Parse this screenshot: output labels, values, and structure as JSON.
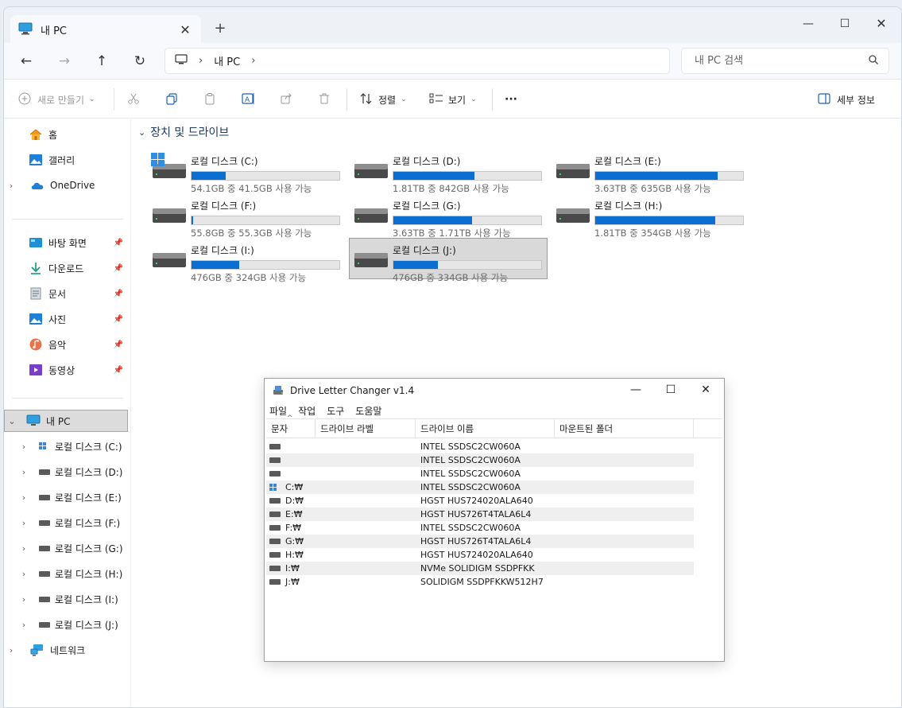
{
  "tab": {
    "title": "내 PC",
    "close": "✕",
    "new": "+"
  },
  "window_controls": {
    "minimize": "—",
    "maximize": "☐",
    "close": "✕"
  },
  "nav": {
    "back": "←",
    "forward": "→",
    "up": "↑",
    "refresh": "↻"
  },
  "address": {
    "separator": "›",
    "crumb": "내 PC"
  },
  "search": {
    "placeholder": "내 PC 검색"
  },
  "toolbar": {
    "new": "새로 만들기",
    "sort": "정렬",
    "view": "보기",
    "more": "···",
    "details": "세부 정보"
  },
  "sidebar": {
    "home": "홈",
    "gallery": "갤러리",
    "onedrive": "OneDrive",
    "quick": [
      {
        "label": "바탕 화면",
        "icon": "desktop-icon"
      },
      {
        "label": "다운로드",
        "icon": "download-icon"
      },
      {
        "label": "문서",
        "icon": "documents-icon"
      },
      {
        "label": "사진",
        "icon": "pictures-icon"
      },
      {
        "label": "음악",
        "icon": "music-icon"
      },
      {
        "label": "동영상",
        "icon": "videos-icon"
      }
    ],
    "this_pc": "내 PC",
    "drives": [
      "로컬 디스크 (C:)",
      "로컬 디스크 (D:)",
      "로컬 디스크 (E:)",
      "로컬 디스크 (F:)",
      "로컬 디스크 (G:)",
      "로컬 디스크 (H:)",
      "로컬 디스크 (I:)",
      "로컬 디스크 (J:)"
    ],
    "network": "네트워크"
  },
  "content": {
    "section_title": "장치 및 드라이브",
    "drives": [
      {
        "name": "로컬 디스크 (C:)",
        "size": "54.1GB 중 41.5GB 사용 가능",
        "used_fraction": 0.23,
        "system": true
      },
      {
        "name": "로컬 디스크 (D:)",
        "size": "1.81TB 중 842GB 사용 가능",
        "used_fraction": 0.55
      },
      {
        "name": "로컬 디스크 (E:)",
        "size": "3.63TB 중 635GB 사용 가능",
        "used_fraction": 0.83
      },
      {
        "name": "로컬 디스크 (F:)",
        "size": "55.8GB 중 55.3GB 사용 가능",
        "used_fraction": 0.01
      },
      {
        "name": "로컬 디스크 (G:)",
        "size": "3.63TB 중 1.71TB 사용 가능",
        "used_fraction": 0.53
      },
      {
        "name": "로컬 디스크 (H:)",
        "size": "1.81TB 중 354GB 사용 가능",
        "used_fraction": 0.81
      },
      {
        "name": "로컬 디스크 (I:)",
        "size": "476GB 중 324GB 사용 가능",
        "used_fraction": 0.32
      },
      {
        "name": "로컬 디스크 (J:)",
        "size": "476GB 중 334GB 사용 가능",
        "used_fraction": 0.3,
        "selected": true
      }
    ]
  },
  "dlc": {
    "title": "Drive Letter Changer v1.4",
    "menu": [
      "파일",
      "작업",
      "도구",
      "도움말"
    ],
    "columns": [
      "문자",
      "드라이브 라벨",
      "드라이브 이름",
      "마운트된 폴더"
    ],
    "rows": [
      {
        "letter": "",
        "name": "INTEL SSDSC2CW060A",
        "type": "drive"
      },
      {
        "letter": "",
        "name": "INTEL SSDSC2CW060A",
        "type": "drive"
      },
      {
        "letter": "",
        "name": "INTEL SSDSC2CW060A",
        "type": "drive"
      },
      {
        "letter": "C:₩",
        "name": "INTEL SSDSC2CW060A",
        "type": "system"
      },
      {
        "letter": "D:₩",
        "name": "HGST HUS724020ALA640",
        "type": "drive"
      },
      {
        "letter": "E:₩",
        "name": "HGST HUS726T4TALA6L4",
        "type": "drive"
      },
      {
        "letter": "F:₩",
        "name": "INTEL SSDSC2CW060A",
        "type": "drive"
      },
      {
        "letter": "G:₩",
        "name": "HGST HUS726T4TALA6L4",
        "type": "drive"
      },
      {
        "letter": "H:₩",
        "name": "HGST HUS724020ALA640",
        "type": "drive"
      },
      {
        "letter": "I:₩",
        "name": "NVMe SOLIDIGM SSDPFKK",
        "type": "drive"
      },
      {
        "letter": "J:₩",
        "name": "SOLIDIGM SSDPFKKW512H7",
        "type": "drive"
      }
    ]
  },
  "colors": {
    "accent": "#0a6fd0",
    "selection": "#d9d9d9"
  }
}
